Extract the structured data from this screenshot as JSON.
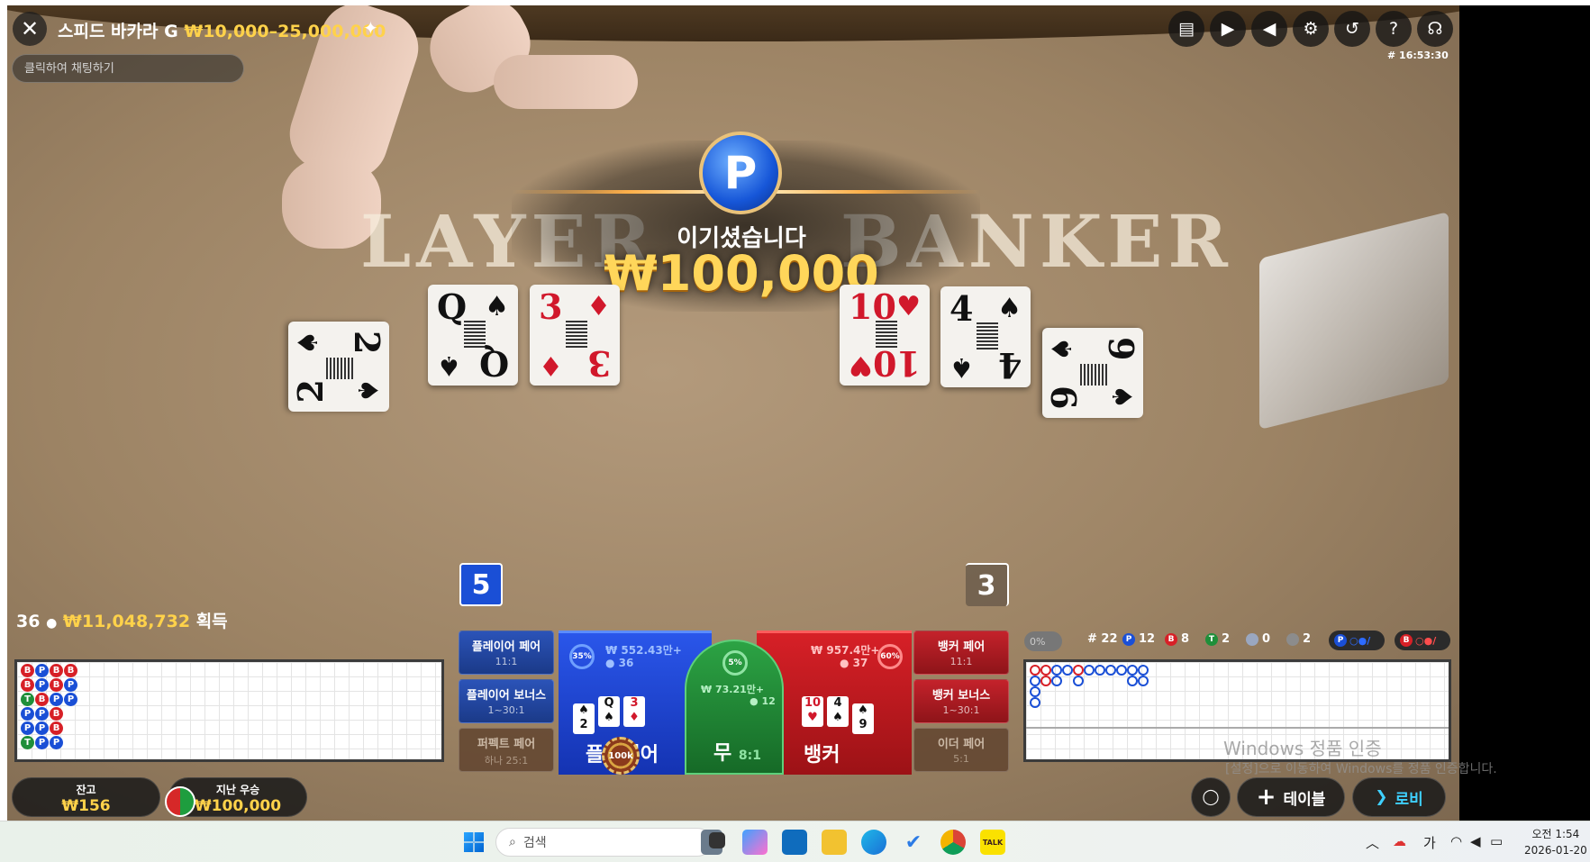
{
  "header": {
    "table_name": "스피드 바카라 G",
    "limits": "₩10,000–25,000,000",
    "chat_placeholder": "클릭하여 채팅하기",
    "round_id": "# 16:53:30"
  },
  "top_icons": [
    "chat-icon",
    "video-icon",
    "volume-icon",
    "settings-icon",
    "history-icon",
    "help-icon",
    "support-icon"
  ],
  "felt": {
    "player": "LAYER",
    "banker": "BANKER"
  },
  "cards": {
    "player": [
      {
        "rank": "2",
        "suit": "♠",
        "color": "black"
      },
      {
        "rank": "Q",
        "suit": "♠",
        "color": "black"
      },
      {
        "rank": "3",
        "suit": "♦",
        "color": "red"
      }
    ],
    "banker": [
      {
        "rank": "10",
        "suit": "♥",
        "color": "red"
      },
      {
        "rank": "4",
        "suit": "♠",
        "color": "black"
      },
      {
        "rank": "9",
        "suit": "♠",
        "color": "black"
      }
    ]
  },
  "win": {
    "badge": "P",
    "title": "이기셨습니다",
    "amount": "₩100,000"
  },
  "scores": {
    "player": "5",
    "banker": "3"
  },
  "players_info": {
    "count": "36",
    "amount": "₩11,048,732",
    "suffix": "획득"
  },
  "bead_road": [
    [
      "B",
      "P",
      "B",
      "B"
    ],
    [
      "B",
      "P",
      "B",
      "P"
    ],
    [
      "T",
      "B",
      "P",
      "P"
    ],
    [
      "P",
      "P",
      "B"
    ],
    [
      "P",
      "P",
      "B"
    ],
    [
      "T",
      "P",
      "P"
    ]
  ],
  "stats": {
    "pct": "0%",
    "rounds": "# 22",
    "player_label": "P",
    "player_count": "12",
    "banker_label": "B",
    "banker_count": "8",
    "tie_label": "T",
    "tie_count": "2",
    "player_pair_count": "0",
    "banker_pair_count": "2",
    "ask_player": "P",
    "ask_banker": "B"
  },
  "bets": {
    "player_pair": {
      "label": "플레이어 페어",
      "odds": "11:1"
    },
    "player_bonus": {
      "label": "플레이어 보너스",
      "odds": "1~30:1"
    },
    "perfect_pair": {
      "label": "퍼펙트 페어",
      "odds": "하나 25:1"
    },
    "banker_pair": {
      "label": "뱅커 페어",
      "odds": "11:1"
    },
    "banker_bonus": {
      "label": "뱅커 보너스",
      "odds": "1~30:1"
    },
    "either_pair": {
      "label": "이더 페어",
      "odds": "5:1"
    },
    "player": {
      "label": "플레이어",
      "pool": "₩ 552.43만+",
      "players": "36",
      "pct": "35%"
    },
    "tie": {
      "label": "무",
      "odds": "8:1",
      "pool": "₩ 73.21만+",
      "players": "12",
      "pct": "5%"
    },
    "banker": {
      "label": "뱅커",
      "pool": "₩ 957.4만+",
      "players": "37",
      "pct": "60%"
    },
    "chip_label": "100k"
  },
  "balance": {
    "label": "잔고",
    "value": "₩156",
    "last_win_label": "지난 우승",
    "last_win_value": "₩100,000"
  },
  "buttons": {
    "table": "테이블",
    "lobby": "로비"
  },
  "watermark": {
    "line1": "Windows 정품 인증",
    "line2": "[설정]으로 이동하여 Windows를 정품 인증합니다."
  },
  "taskbar": {
    "search": "검색",
    "ime": "가",
    "time": "오전 1:54",
    "date": "2026-01-20"
  },
  "colors": {
    "player": "#1a4fd6",
    "banker": "#d72027",
    "tie": "#1f8f3a",
    "gold": "#ffd24a"
  }
}
